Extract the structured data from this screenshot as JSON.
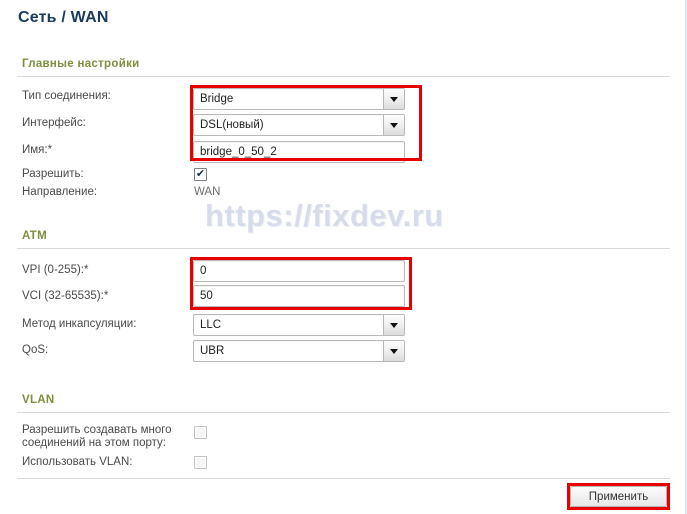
{
  "page": {
    "title": "Сеть / WAN",
    "watermark": "https://fixdev.ru",
    "accent_header_color": "#7d8f3c",
    "title_color": "#1b3a5e",
    "highlight_color": "#e60000"
  },
  "sections": {
    "main": {
      "header": "Главные настройки",
      "fields": [
        {
          "label": "Тип соединения:",
          "value": "Bridge",
          "control": "select"
        },
        {
          "label": "Интерфейс:",
          "value": "DSL(новый)",
          "control": "select"
        },
        {
          "label": "Имя:*",
          "value": "bridge_0_50_2",
          "control": "text"
        },
        {
          "label": "Разрешить:",
          "value": "",
          "control": "checkbox",
          "checked": true
        },
        {
          "label": "Направление:",
          "value": "WAN",
          "control": "static"
        }
      ]
    },
    "atm": {
      "header": "ATM",
      "fields": [
        {
          "label": "VPI (0-255):*",
          "value": "0",
          "control": "text"
        },
        {
          "label": "VCI (32-65535):*",
          "value": "50",
          "control": "text"
        },
        {
          "label": "Метод инкапсуляции:",
          "value": "LLC",
          "control": "select"
        },
        {
          "label": "QoS:",
          "value": "UBR",
          "control": "select"
        }
      ]
    },
    "vlan": {
      "header": "VLAN",
      "fields": [
        {
          "label": "Разрешить создавать много соединений на этом порту:",
          "value": "",
          "control": "checkbox",
          "checked": false
        },
        {
          "label": "Использовать VLAN:",
          "value": "",
          "control": "checkbox",
          "checked": false
        }
      ]
    }
  },
  "footer": {
    "apply_label": "Применить"
  },
  "icons": {
    "checkmark": "✔",
    "dropdown": "chevron-down-icon"
  }
}
